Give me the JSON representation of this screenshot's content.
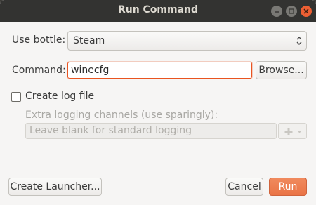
{
  "window": {
    "title": "Run Command",
    "controls": {
      "minimize_icon": "minimize-icon",
      "maximize_icon": "maximize-icon",
      "close_icon": "close-icon"
    }
  },
  "form": {
    "bottle_label": "Use bottle:",
    "bottle_value": "Steam",
    "command_label": "Command:",
    "command_value": "winecfg",
    "browse_label": "Browse...",
    "log_checkbox_label": "Create log file",
    "log_checked": false,
    "logging_channels_label": "Extra logging channels (use sparingly):",
    "logging_placeholder": "Leave blank for standard logging",
    "add_icon": "add-icon"
  },
  "footer": {
    "launcher_label": "Create Launcher...",
    "cancel_label": "Cancel",
    "run_label": "Run"
  },
  "colors": {
    "accent": "#e95420",
    "run_button": "#ea7446",
    "close_button": "#ed5f33",
    "titlebar": "#333331"
  }
}
